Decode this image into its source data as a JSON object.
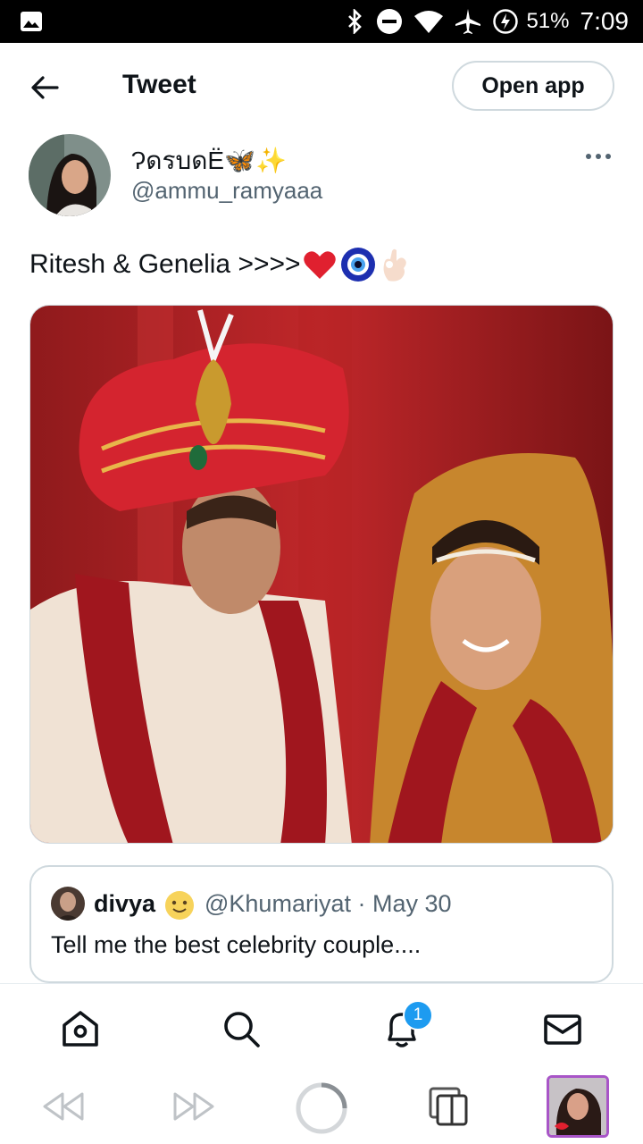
{
  "status_bar": {
    "battery": "51%",
    "time": "7:09",
    "icons": [
      "gallery-icon",
      "bluetooth-icon",
      "do-not-disturb-icon",
      "wifi-icon",
      "airplane-icon",
      "battery-charging-icon"
    ]
  },
  "header": {
    "title": "Tweet",
    "open_app_label": "Open app"
  },
  "tweet": {
    "display_name": "ɁดรบดЁ🦋✨",
    "handle": "@ammu_ramyaaa",
    "text": "Ritesh & Genelia >>>>",
    "text_emojis": [
      "red-heart-icon",
      "nazar-amulet-icon",
      "ok-hand-icon"
    ],
    "image_alt": "wedding photo"
  },
  "quote": {
    "name": "divya",
    "handle": "@Khumariyat",
    "separator": "·",
    "date": "May 30",
    "text": "Tell me the best celebrity couple...."
  },
  "bottom_nav": {
    "items": [
      "home",
      "search",
      "notifications",
      "messages"
    ],
    "notification_count": "1"
  },
  "colors": {
    "accent": "#1d9bf0",
    "text": "#0f1419",
    "muted": "#536471",
    "border": "#cfd9de"
  }
}
